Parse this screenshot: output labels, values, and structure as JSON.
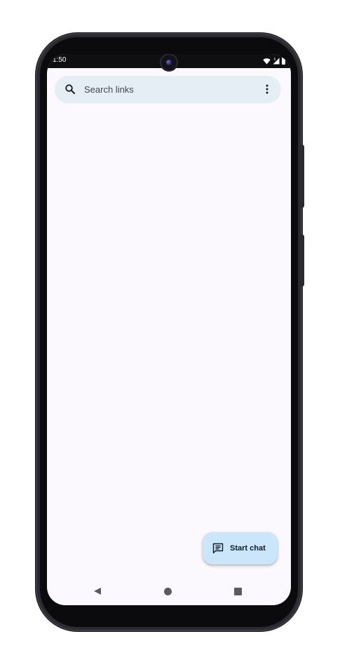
{
  "status_bar": {
    "time": "1:50",
    "icons": [
      "wifi-icon",
      "signal-icon",
      "battery-icon"
    ]
  },
  "search": {
    "placeholder": "Search links",
    "icon": "search-icon",
    "menu_icon": "more-vert-icon"
  },
  "fab": {
    "label": "Start chat",
    "icon": "chat-icon"
  },
  "nav_bar": {
    "buttons": [
      "back-icon",
      "home-icon",
      "recents-icon"
    ]
  },
  "colors": {
    "background": "#fbf8fe",
    "search_bar": "#e5edf5",
    "fab": "#cbe6fb",
    "fab_text": "#0c1d2b",
    "nav_icon": "#5b5a5f"
  }
}
